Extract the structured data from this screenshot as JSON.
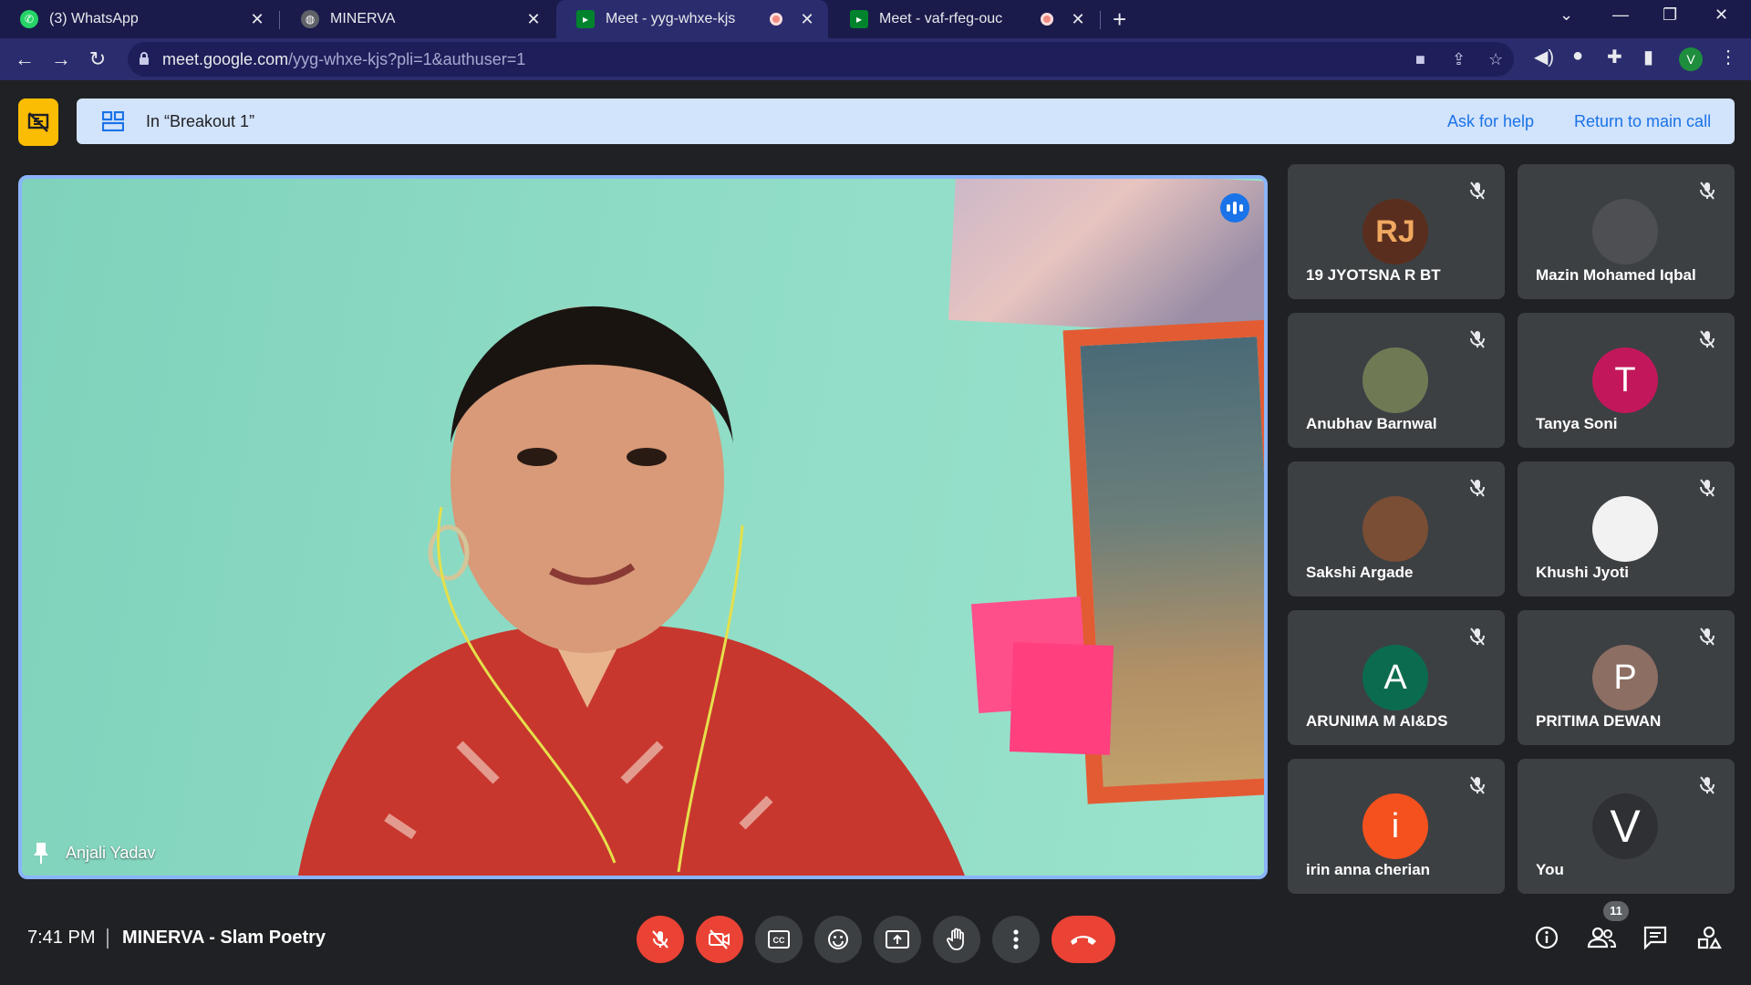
{
  "browser": {
    "tabs": [
      {
        "title": "(3) WhatsApp",
        "icon": "whatsapp-icon",
        "active": false
      },
      {
        "title": "MINERVA",
        "icon": "globe-icon",
        "active": false
      },
      {
        "title": "Meet - yyg-whxe-kjs",
        "icon": "meet-icon",
        "active": true,
        "recording": true
      },
      {
        "title": "Meet - vaf-rfeg-ouc",
        "icon": "meet-icon",
        "active": false,
        "recording": true
      }
    ],
    "url_host": "meet.google.com",
    "url_path": "/yyg-whxe-kjs?pli=1&authuser=1",
    "profile_initial": "V"
  },
  "banner": {
    "room_label": "In “Breakout 1”",
    "ask_help": "Ask for help",
    "return_main": "Return to main call"
  },
  "main_video": {
    "participant_name": "Anjali Yadav"
  },
  "participants": [
    {
      "name": "19 JYOTSNA R BT",
      "avatar": "RJ",
      "avatar_color": "#5a2e1e",
      "muted": true
    },
    {
      "name": "Mazin Mohamed Iqbal",
      "avatar": "",
      "avatar_color": "#4d4f53",
      "muted": true
    },
    {
      "name": "Anubhav Barnwal",
      "avatar": "",
      "avatar_color": "#6f7a55",
      "muted": true
    },
    {
      "name": "Tanya Soni",
      "avatar": "T",
      "avatar_color": "#c2185b",
      "muted": true
    },
    {
      "name": "Sakshi Argade",
      "avatar": "",
      "avatar_color": "#7a4e35",
      "muted": true
    },
    {
      "name": "Khushi Jyoti",
      "avatar": "",
      "avatar_color": "#f2f2f2",
      "muted": true
    },
    {
      "name": "ARUNIMA M AI&DS",
      "avatar": "A",
      "avatar_color": "#0b6b4f",
      "muted": true
    },
    {
      "name": "PRITIMA DEWAN",
      "avatar": "P",
      "avatar_color": "#8d6e63",
      "muted": true
    },
    {
      "name": "irin anna cherian",
      "avatar": "i",
      "avatar_color": "#f4511e",
      "muted": true
    },
    {
      "name": "You",
      "avatar": "V",
      "avatar_color": "#2f3033",
      "muted": true
    }
  ],
  "bottom": {
    "time": "7:41 PM",
    "meeting_name": "MINERVA - Slam Poetry",
    "participant_count": "11"
  },
  "colors": {
    "accent": "#1a73e8",
    "danger": "#ea4335",
    "banner_bg": "#d2e3fc",
    "host_badge": "#fbbc04"
  }
}
